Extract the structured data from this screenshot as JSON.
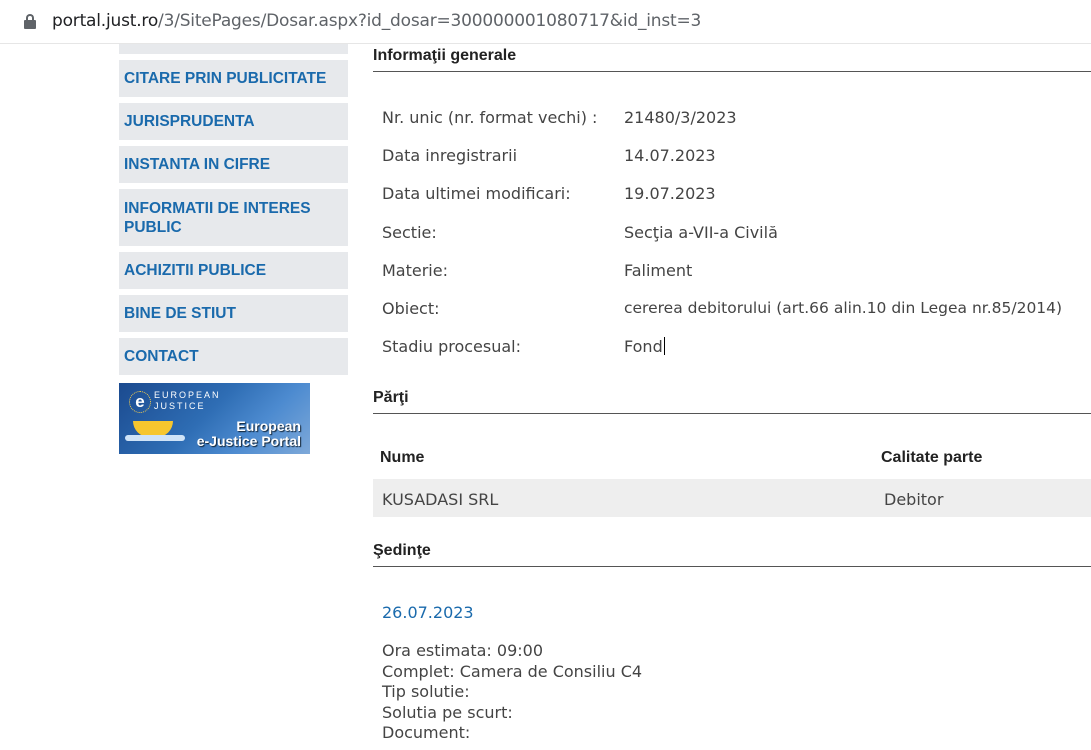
{
  "browser": {
    "url_host": "portal.just.ro",
    "url_path": "/3/SitePages/Dosar.aspx?id_dosar=300000001080717&id_inst=3"
  },
  "sidebar": {
    "items": [
      {
        "label": "CITARE PRIN PUBLICITATE"
      },
      {
        "label": "JURISPRUDENTA"
      },
      {
        "label": "INSTANTA IN CIFRE"
      },
      {
        "label_line1": "INFORMATII DE INTERES",
        "label_line2": "PUBLIC"
      },
      {
        "label": "ACHIZITII PUBLICE"
      },
      {
        "label": "BINE DE STIUT"
      },
      {
        "label": "CONTACT"
      }
    ],
    "banner": {
      "glyph": "e",
      "small_line1": "EUROPEAN",
      "small_line2": "JUSTICE",
      "line1": "European",
      "line2": "e-Justice Portal"
    }
  },
  "general": {
    "title": "Informaţii generale",
    "rows": [
      {
        "label": "Nr. unic (nr. format vechi) :",
        "value": "21480/3/2023"
      },
      {
        "label": "Data inregistrarii",
        "value": "14.07.2023"
      },
      {
        "label": "Data ultimei modificari:",
        "value": "19.07.2023"
      },
      {
        "label": "Sectie:",
        "value": "Secţia a-VII-a Civilă"
      },
      {
        "label": "Materie:",
        "value": "Faliment"
      },
      {
        "label": "Obiect:",
        "value": "cererea debitorului (art.66 alin.10 din Legea nr.85/2014)"
      },
      {
        "label": "Stadiu procesual:",
        "value": "Fond"
      }
    ]
  },
  "parti": {
    "title": "Părţi",
    "headers": {
      "name": "Nume",
      "role": "Calitate parte"
    },
    "rows": [
      {
        "name": "KUSADASI SRL",
        "role": "Debitor"
      }
    ]
  },
  "sedinte": {
    "title": "Şedinţe",
    "date": "26.07.2023",
    "lines": [
      "Ora estimata: 09:00",
      "Complet: Camera de Consiliu C4",
      "Tip solutie:",
      "Solutia pe scurt:",
      "Document:"
    ]
  },
  "colors": {
    "link": "#1a6aac",
    "nav_bg": "#e7e9ec",
    "row_bg": "#eeeeee"
  }
}
